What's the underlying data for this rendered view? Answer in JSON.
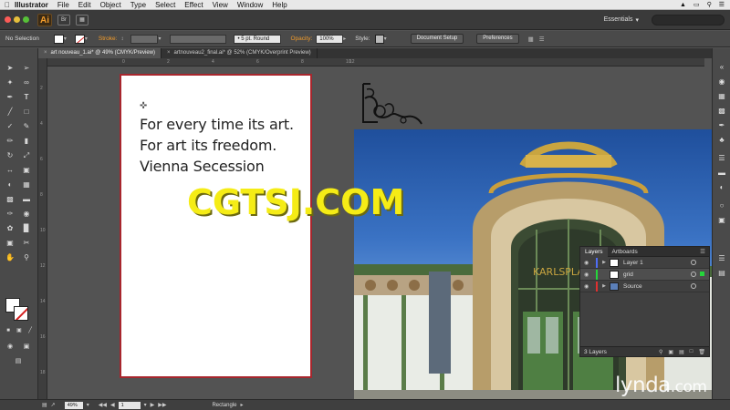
{
  "menubar": {
    "app": "Illustrator",
    "items": [
      "File",
      "Edit",
      "Object",
      "Type",
      "Select",
      "Effect",
      "View",
      "Window",
      "Help"
    ]
  },
  "appbar": {
    "logo": "Ai",
    "bridge_button": "Br",
    "workspace": "Essentials"
  },
  "control": {
    "selection_label": "No Selection",
    "stroke_label": "Stroke:",
    "brush_value": "5 pt. Round",
    "opacity_label": "Opacity:",
    "opacity_value": "100%",
    "style_label": "Style:",
    "document_setup": "Document Setup",
    "preferences": "Preferences"
  },
  "tabs": [
    {
      "label": "art nouveau_1.ai* @ 49% (CMYK/Preview)"
    },
    {
      "label": "artnouveau2_final.ai* @ 52% (CMYK/Overprint Preview)"
    }
  ],
  "ruler": {
    "h_ticks": [
      "0",
      "2",
      "4",
      "6",
      "8",
      "10",
      "12"
    ],
    "v_ticks": [
      "2",
      "4",
      "6",
      "8",
      "10",
      "12",
      "14",
      "16",
      "18"
    ]
  },
  "artboard": {
    "lines": [
      "For every time its art.",
      "For art its freedom.",
      "Vienna Secession"
    ]
  },
  "photo": {
    "sign": "KARLSPLA"
  },
  "watermark": "CGTSJ.COM",
  "layers": {
    "tab_layers": "Layers",
    "tab_artboards": "Artboards",
    "rows": [
      {
        "name": "Layer 1",
        "color": "#4f6df5"
      },
      {
        "name": "grid",
        "color": "#25d63b"
      },
      {
        "name": "Source",
        "color": "#e03030"
      }
    ],
    "count": "3 Layers"
  },
  "status": {
    "zoom": "49%",
    "page": "1",
    "tool": "Rectangle"
  },
  "brand": {
    "name": "lynda",
    "suffix": ".com"
  },
  "colors": {
    "accent": "#f29c2b",
    "artboard_border": "#a8262d",
    "watermark": "#f5ec16"
  }
}
